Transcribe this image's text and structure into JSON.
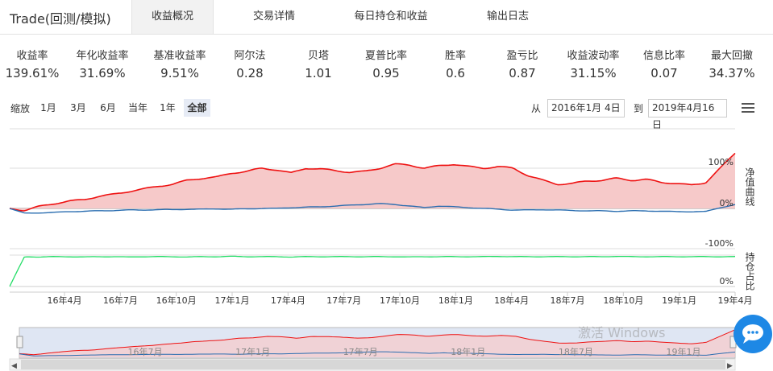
{
  "tabs": {
    "title": "Trade(回测/模拟)",
    "items": [
      "收益概况",
      "交易详情",
      "每日持仓和收益",
      "输出日志"
    ]
  },
  "stats": [
    {
      "label": "收益率",
      "value": "139.61%"
    },
    {
      "label": "年化收益率",
      "value": "31.69%"
    },
    {
      "label": "基准收益率",
      "value": "9.51%"
    },
    {
      "label": "阿尔法",
      "value": "0.28"
    },
    {
      "label": "贝塔",
      "value": "1.01"
    },
    {
      "label": "夏普比率",
      "value": "0.95"
    },
    {
      "label": "胜率",
      "value": "0.6"
    },
    {
      "label": "盈亏比",
      "value": "0.87"
    },
    {
      "label": "收益波动率",
      "value": "31.15%"
    },
    {
      "label": "信息比率",
      "value": "0.07"
    },
    {
      "label": "最大回撤",
      "value": "34.37%"
    }
  ],
  "range": {
    "zoom_label": "缩放",
    "buttons": [
      "1月",
      "3月",
      "6月",
      "当年",
      "1年",
      "全部"
    ],
    "active": "全部",
    "from_label": "从",
    "from_date": "2016年1月 4日",
    "to_label": "到",
    "to_date": "2019年4月16日"
  },
  "chart_data": {
    "type": "line",
    "x_ticks": [
      "16年4月",
      "16年7月",
      "16年10月",
      "17年1月",
      "17年4月",
      "17年7月",
      "17年10月",
      "18年1月",
      "18年4月",
      "18年7月",
      "18年10月",
      "19年1月",
      "19年4月"
    ],
    "navigator_ticks": [
      "16年7月",
      "17年1月",
      "17年7月",
      "18年1月",
      "18年7月",
      "19年1月"
    ],
    "main_axis_title": "净值曲线",
    "main_y_ticks": [
      "100%",
      "0%",
      "-100%"
    ],
    "ylim": [
      -100,
      100
    ],
    "position_axis_title": "持仓占比",
    "position_y_ticks": [
      "0%"
    ],
    "series": [
      {
        "color": "#ee1111",
        "fill": "#f6c9c9",
        "values": [
          0,
          -5,
          5,
          12,
          18,
          22,
          30,
          35,
          42,
          48,
          55,
          60,
          70,
          75,
          78,
          88,
          92,
          100,
          96,
          88,
          100,
          98,
          94,
          90,
          92,
          100,
          110,
          108,
          100,
          106,
          110,
          104,
          100,
          104,
          100,
          82,
          70,
          60,
          62,
          68,
          70,
          75,
          70,
          72,
          65,
          62,
          58,
          64,
          100,
          138
        ]
      },
      {
        "color": "#2a6db0",
        "values": [
          0,
          -12,
          -11,
          -10,
          -8,
          -7,
          -6,
          -5,
          -4,
          -4,
          -3,
          -3,
          -2,
          -2,
          -1,
          -2,
          -1,
          0,
          0,
          2,
          3,
          4,
          6,
          8,
          10,
          12,
          10,
          6,
          2,
          6,
          4,
          2,
          0,
          -2,
          -4,
          -4,
          -3,
          -4,
          -5,
          -6,
          -6,
          -7,
          -6,
          -6,
          -7,
          -8,
          -8,
          -8,
          2,
          9.5
        ]
      }
    ],
    "position_series": {
      "color": "#22dd66",
      "values": [
        0,
        95,
        94,
        95,
        95,
        94,
        95,
        95,
        94,
        95,
        95,
        95,
        94,
        95,
        95,
        96,
        95,
        95,
        95,
        94,
        95,
        95,
        95,
        95,
        95,
        95,
        95,
        94,
        95,
        95,
        95,
        95,
        95,
        96,
        95,
        95,
        95,
        95,
        95,
        95,
        95,
        96,
        95,
        95,
        95,
        95,
        95,
        95,
        95,
        95
      ]
    }
  },
  "watermark": "激活 Windows"
}
